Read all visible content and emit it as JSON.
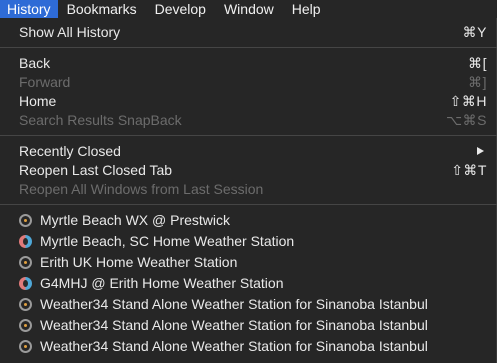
{
  "menubar": {
    "items": [
      "History",
      "Bookmarks",
      "Develop",
      "Window",
      "Help"
    ]
  },
  "menu": {
    "show_all_history": {
      "label": "Show All History",
      "shortcut": "⌘Y"
    },
    "back": {
      "label": "Back",
      "shortcut": "⌘["
    },
    "forward": {
      "label": "Forward",
      "shortcut": "⌘]"
    },
    "home": {
      "label": "Home",
      "shortcut": "⇧⌘H"
    },
    "snapback": {
      "label": "Search Results SnapBack",
      "shortcut": "⌥⌘S"
    },
    "recently_closed": {
      "label": "Recently Closed"
    },
    "reopen_tab": {
      "label": "Reopen Last Closed Tab",
      "shortcut": "⇧⌘T"
    },
    "reopen_windows": {
      "label": "Reopen All Windows from Last Session"
    }
  },
  "history": [
    {
      "label": "Myrtle Beach WX @ Prestwick",
      "icon": "weather34-icon"
    },
    {
      "label": "Myrtle Beach, SC Home Weather Station",
      "icon": "weather-station-icon"
    },
    {
      "label": "Erith UK Home Weather Station",
      "icon": "weather34-icon"
    },
    {
      "label": "G4MHJ @ Erith Home Weather Station",
      "icon": "weather-station-icon"
    },
    {
      "label": "Weather34 Stand Alone Weather Station for Sinanoba Istanbul",
      "icon": "weather34-icon"
    },
    {
      "label": "Weather34 Stand Alone Weather Station for Sinanoba Istanbul",
      "icon": "weather34-icon"
    },
    {
      "label": "Weather34 Stand Alone Weather Station for Sinanoba Istanbul",
      "icon": "weather34-icon"
    }
  ]
}
